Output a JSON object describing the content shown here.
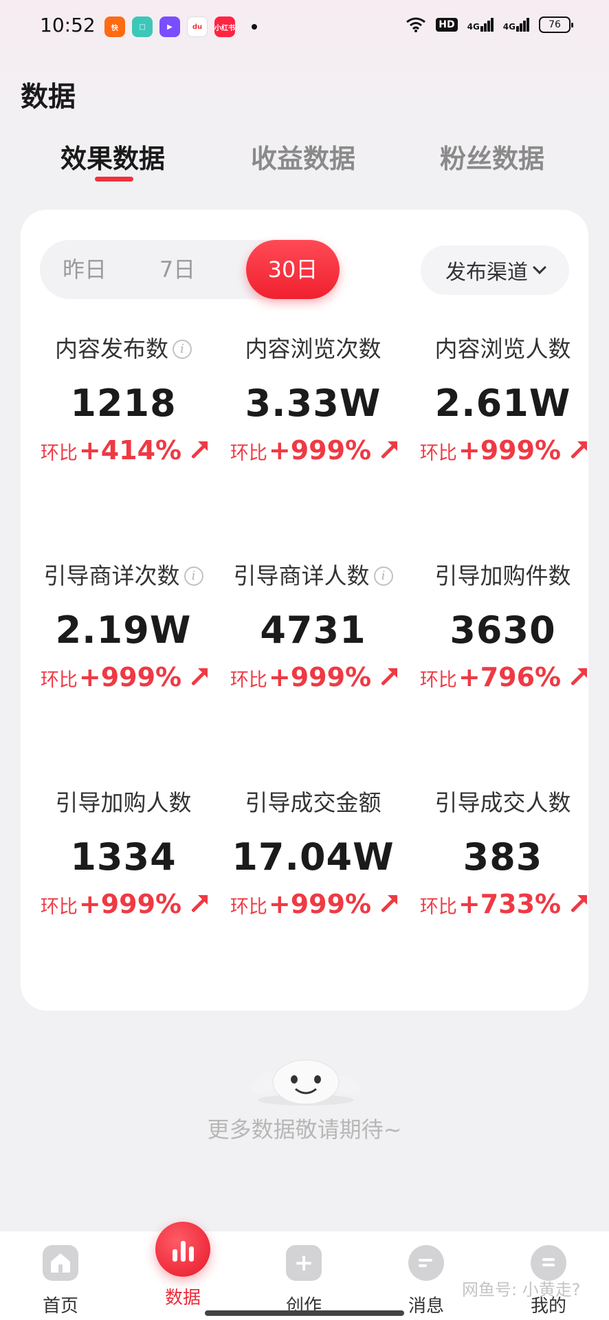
{
  "status_bar": {
    "time": "10:52",
    "notif_icons": [
      "快",
      "□",
      "▶",
      "du",
      "小红书"
    ],
    "hd": "HD",
    "net1": "4G",
    "net2": "4G",
    "battery": "76"
  },
  "page": {
    "title": "数据"
  },
  "tabs": [
    {
      "label": "效果数据",
      "active": true
    },
    {
      "label": "收益数据",
      "active": false
    },
    {
      "label": "粉丝数据",
      "active": false
    }
  ],
  "range": {
    "options": [
      "昨日",
      "7日",
      "30日"
    ],
    "selected": "30日"
  },
  "channel": {
    "label": "发布渠道"
  },
  "metrics": [
    {
      "label": "内容发布数",
      "value": "1218",
      "change_prefix": "环比",
      "change": "+414%",
      "info": true
    },
    {
      "label": "内容浏览次数",
      "value": "3.33W",
      "change_prefix": "环比",
      "change": "+999%",
      "info": false
    },
    {
      "label": "内容浏览人数",
      "value": "2.61W",
      "change_prefix": "环比",
      "change": "+999%",
      "info": false
    },
    {
      "label": "引导商详次数",
      "value": "2.19W",
      "change_prefix": "环比",
      "change": "+999%",
      "info": true
    },
    {
      "label": "引导商详人数",
      "value": "4731",
      "change_prefix": "环比",
      "change": "+999%",
      "info": true
    },
    {
      "label": "引导加购件数",
      "value": "3630",
      "change_prefix": "环比",
      "change": "+796%",
      "info": false
    },
    {
      "label": "引导加购人数",
      "value": "1334",
      "change_prefix": "环比",
      "change": "+999%",
      "info": false
    },
    {
      "label": "引导成交金额",
      "value": "17.04W",
      "change_prefix": "环比",
      "change": "+999%",
      "info": false
    },
    {
      "label": "引导成交人数",
      "value": "383",
      "change_prefix": "环比",
      "change": "+733%",
      "info": false
    }
  ],
  "empty_state": {
    "text": "更多数据敬请期待~"
  },
  "bottom_nav": [
    {
      "label": "首页",
      "icon": "home-icon"
    },
    {
      "label": "数据",
      "icon": "chart-icon",
      "active": true
    },
    {
      "label": "创作",
      "icon": "plus-icon"
    },
    {
      "label": "消息",
      "icon": "message-icon"
    },
    {
      "label": "我的",
      "icon": "profile-icon"
    }
  ],
  "watermark": "网鱼号: 小黄走?"
}
